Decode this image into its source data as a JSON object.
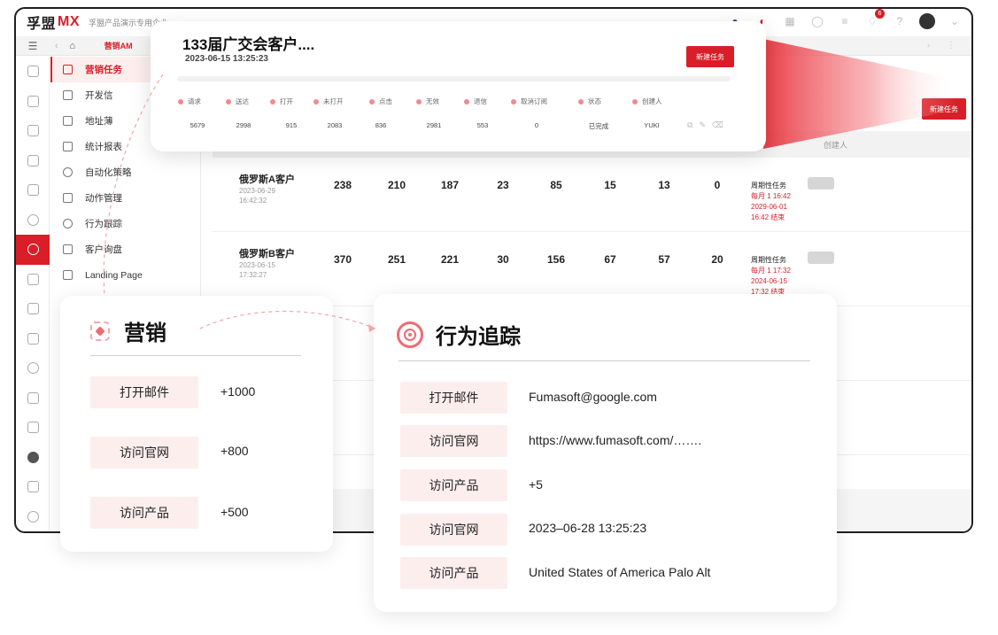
{
  "app": {
    "brand_cn": "孚盟",
    "brand_mx": "MX",
    "org": "孚盟产品演示专用企业",
    "notification_count": "6"
  },
  "tabbar": {
    "active_tab": "营销AM"
  },
  "sidebar": {
    "items": [
      {
        "label": "营销任务",
        "icon": "mail-icon"
      },
      {
        "label": "开发信",
        "icon": "send-icon"
      },
      {
        "label": "地址薄",
        "icon": "address-book-icon"
      },
      {
        "label": "统计报表",
        "icon": "report-icon"
      },
      {
        "label": "自动化策略",
        "icon": "automation-icon"
      },
      {
        "label": "动作管理",
        "icon": "action-icon"
      },
      {
        "label": "行为跟踪",
        "icon": "tracking-icon"
      },
      {
        "label": "客户询盘",
        "icon": "inquiry-icon"
      },
      {
        "label": "Landing Page",
        "icon": "landing-page-icon"
      }
    ]
  },
  "main": {
    "new_task_label": "新建任务",
    "header_creator": "创建人",
    "rows": [
      {
        "name": "俄罗斯A客户",
        "date": "2023-06-29",
        "time": "16:42:32",
        "values": [
          "238",
          "210",
          "187",
          "23",
          "85",
          "15",
          "13",
          "0"
        ],
        "type": "周期性任务",
        "schedule": "每月 1 16:42",
        "end": "2029-06-01",
        "end_time": "16:42 结束"
      },
      {
        "name": "俄罗斯B客户",
        "date": "2023-06-15",
        "time": "17:32:27",
        "values": [
          "370",
          "251",
          "221",
          "30",
          "156",
          "67",
          "57",
          "20"
        ],
        "type": "周期性任务",
        "schedule": "每月 1 17:32",
        "end": "2024-06-15",
        "end_time": "17:32 结束"
      }
    ]
  },
  "task_card": {
    "title": "133届广交会客户....",
    "time": "2023-06-15 13:25:23",
    "button": "新建任务",
    "stats": [
      {
        "label": "请求",
        "value": "5679"
      },
      {
        "label": "送达",
        "value": "2998"
      },
      {
        "label": "打开",
        "value": "915"
      },
      {
        "label": "未打开",
        "value": "2083"
      },
      {
        "label": "点击",
        "value": "836"
      },
      {
        "label": "无效",
        "value": "2981"
      },
      {
        "label": "退信",
        "value": "553"
      },
      {
        "label": "取消订阅",
        "value": "0"
      },
      {
        "label": "状态",
        "value": "已完成"
      },
      {
        "label": "创建人",
        "value": "YUKI"
      }
    ]
  },
  "marketing_card": {
    "title": "营销",
    "rows": [
      {
        "label": "打开邮件",
        "value": "+1000"
      },
      {
        "label": "访问官网",
        "value": "+800"
      },
      {
        "label": "访问产品",
        "value": "+500"
      }
    ]
  },
  "tracking_card": {
    "title": "行为追踪",
    "rows": [
      {
        "label": "打开邮件",
        "value": "Fumasoft@google.com"
      },
      {
        "label": "访问官网",
        "value": "https://www.fumasoft.com/……."
      },
      {
        "label": "访问产品",
        "value": "+5"
      },
      {
        "label": "访问官网",
        "value": "2023–06-28 13:25:23"
      },
      {
        "label": "访问产品",
        "value": "United States of America Palo Alt"
      }
    ]
  },
  "colors": {
    "accent": "#d91e28",
    "pill_bg": "#fdeeee",
    "stat_dot": "#f08a8f"
  }
}
